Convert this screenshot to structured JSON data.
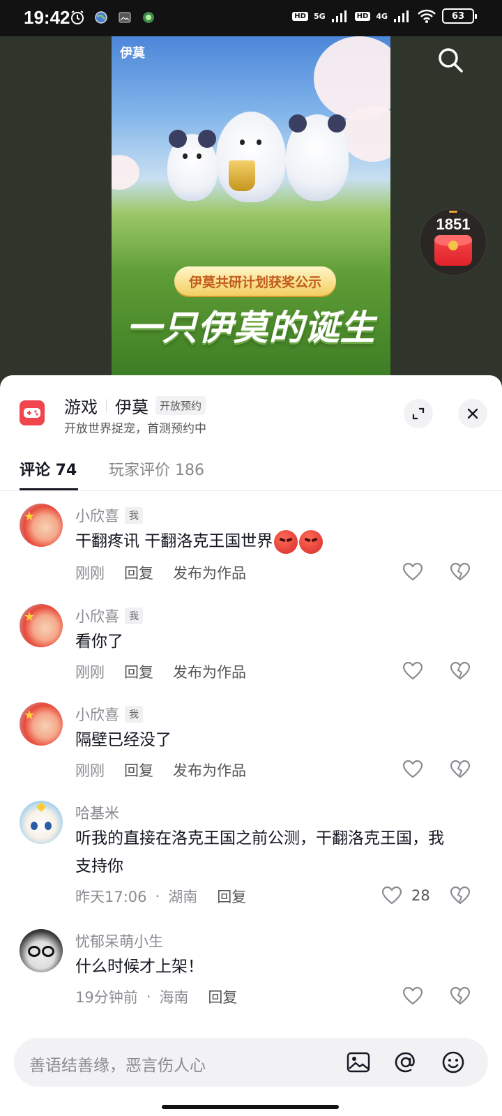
{
  "status_bar": {
    "time": "19:42",
    "battery": "63",
    "network_1": "5G",
    "network_2": "4G",
    "hd_label": "HD"
  },
  "poster": {
    "logo": "伊莫",
    "ribbon": "伊莫共研计划获奖公示",
    "title": "一只伊莫的诞生"
  },
  "red_packet": {
    "count": "1851"
  },
  "game": {
    "category": "游戏",
    "name": "伊莫",
    "badge": "开放预约",
    "subtitle": "开放世界捉宠，首测预约中"
  },
  "tabs": [
    {
      "label": "评论 74",
      "active": true
    },
    {
      "label": "玩家评价 186",
      "active": false
    }
  ],
  "comments": [
    {
      "author": "小欣喜",
      "me_tag": "我",
      "text": "干翻疼讯  干翻洛克王国世界",
      "emoji": "angry-face x2",
      "time": "刚刚",
      "reply": "回复",
      "publish": "发布为作品"
    },
    {
      "author": "小欣喜",
      "me_tag": "我",
      "text": "看你了",
      "time": "刚刚",
      "reply": "回复",
      "publish": "发布为作品"
    },
    {
      "author": "小欣喜",
      "me_tag": "我",
      "text": "隔壁已经没了",
      "time": "刚刚",
      "reply": "回复",
      "publish": "发布为作品"
    },
    {
      "author": "哈基米",
      "text_line1": "听我的直接在洛克王国之前公测，干翻洛克王国，我",
      "text_line2": "支持你",
      "time": "昨天17:06",
      "location": "湖南",
      "reply": "回复",
      "likes": "28"
    },
    {
      "author": "忧郁呆萌小生",
      "text": "什么时候才上架！",
      "time": "19分钟前",
      "location": "海南",
      "reply": "回复"
    }
  ],
  "input": {
    "placeholder": "善语结善缘，恶言伤人心"
  },
  "colors": {
    "accent_red": "#f0454d",
    "text_primary": "#161823",
    "text_secondary": "#8a8b91"
  }
}
